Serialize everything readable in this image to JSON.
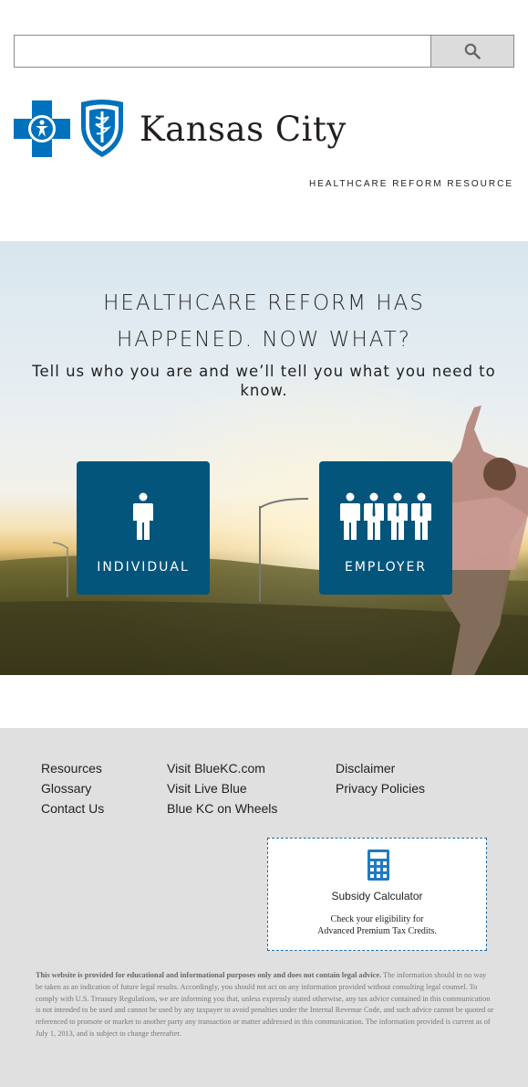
{
  "search": {
    "value": "",
    "placeholder": "",
    "button_icon": "search-icon"
  },
  "header": {
    "brand_name": "Kansas City",
    "tagline": "HEALTHCARE REFORM RESOURCE",
    "brand_color": "#0071bc"
  },
  "hero": {
    "title_line1": "HEALTHCARE REFORM HAS",
    "title_line2": "HAPPENED. NOW WHAT?",
    "subtitle": "Tell us who you are and we’ll tell you what you need to know.",
    "tiles": [
      {
        "label": "INDIVIDUAL",
        "icon": "person-icon"
      },
      {
        "label": "EMPLOYER",
        "icon": "group-icon"
      }
    ],
    "tile_color": "#04557c"
  },
  "footer": {
    "links_col1": [
      "Resources",
      "Glossary",
      "Contact Us"
    ],
    "links_col2": [
      "Visit BlueKC.com",
      "Visit Live Blue",
      "Blue KC on Wheels"
    ],
    "links_col3": [
      "Disclaimer",
      "Privacy Policies"
    ],
    "calculator": {
      "icon": "calculator-icon",
      "title": "Subsidy Calculator",
      "desc_line1": "Check your eligibility for",
      "desc_line2": "Advanced Premium Tax Credits."
    },
    "disclaimer_bold": "This website is provided for educational and informational purposes only and does not contain legal advice.",
    "disclaimer_text": " The information should in no way be taken as an indication of future legal results. Accordingly, you should not act on any information provided without consulting legal counsel. To comply with U.S. Treasury Regulations, we are informing you that, unless expressly stated otherwise, any tax advice contained in this communication is not intended to be used and cannot be used by any taxpayer to avoid penalties under the Internal Revenue Code, and such advice cannot be quoted or referenced to promote or market to another party any transaction or matter addressed in this communication. The information provided is current as of July 1, 2013, and is subject to change thereafter."
  }
}
